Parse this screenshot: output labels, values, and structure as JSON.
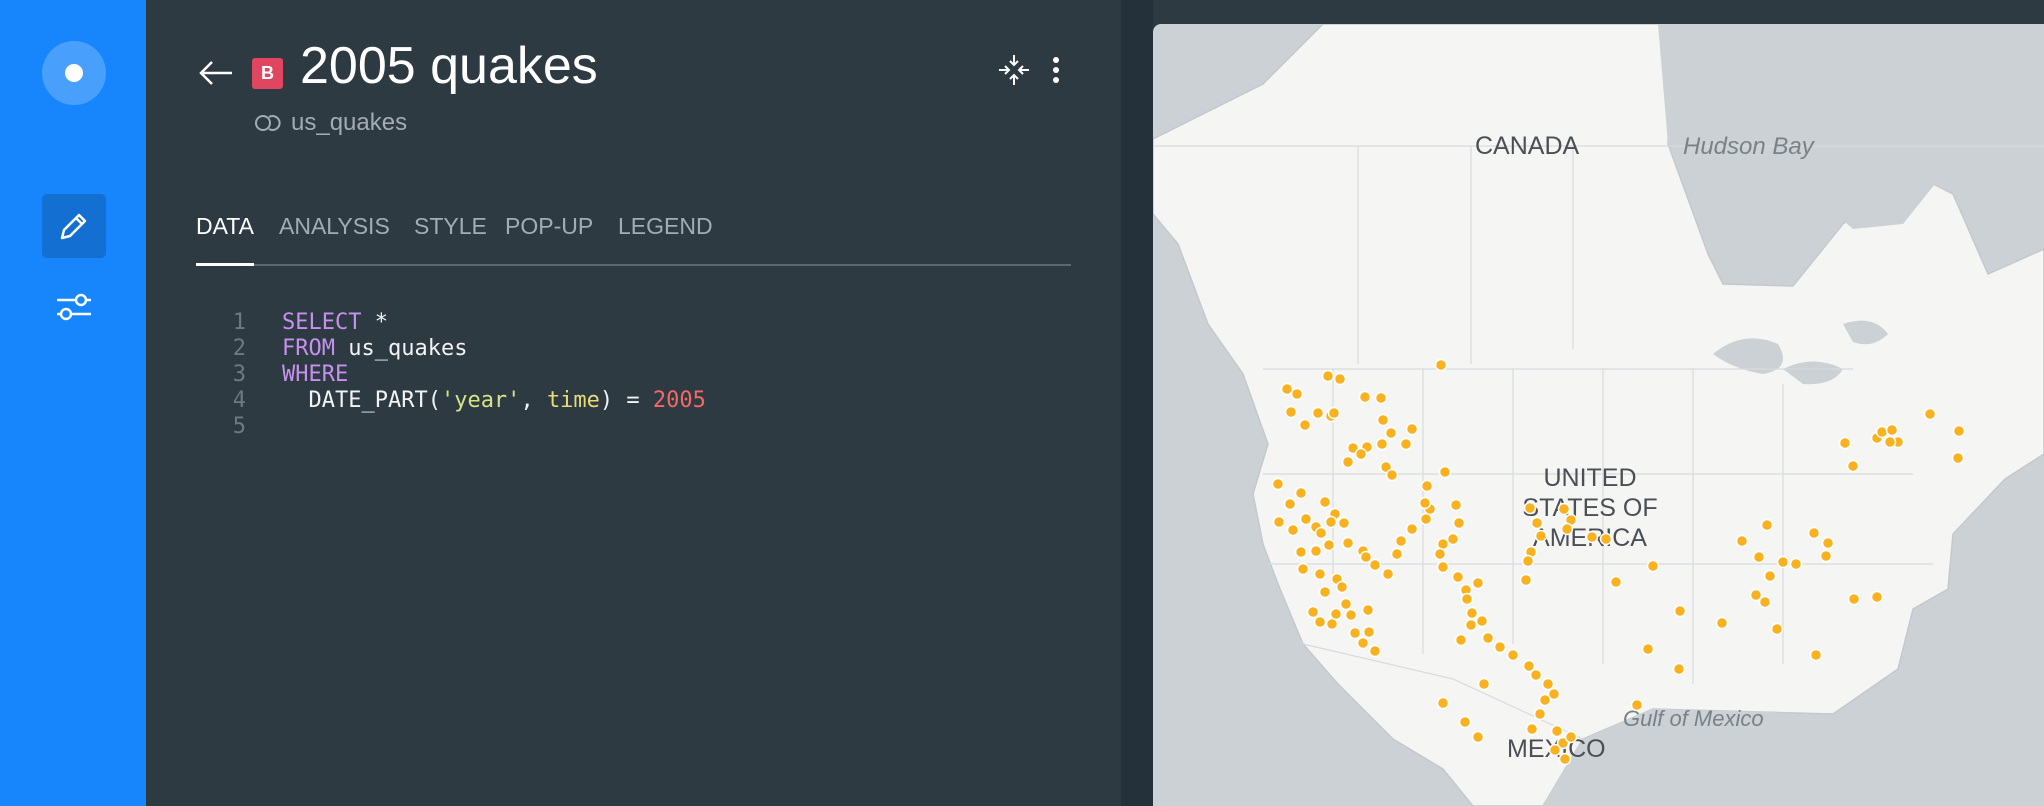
{
  "sidebar": {
    "logo_icon": "carto-logo-icon",
    "items": [
      {
        "name": "edit",
        "icon": "pencil-icon",
        "active": true
      },
      {
        "name": "settings",
        "icon": "sliders-icon",
        "active": false
      }
    ]
  },
  "layer": {
    "badge": "B",
    "title": "2005 quakes",
    "source": "us_quakes"
  },
  "tabs": [
    {
      "label": "DATA",
      "active": true
    },
    {
      "label": "ANALYSIS",
      "active": false
    },
    {
      "label": "STYLE",
      "active": false
    },
    {
      "label": "POP-UP",
      "active": false
    },
    {
      "label": "LEGEND",
      "active": false
    }
  ],
  "sql": {
    "line_numbers": [
      "1",
      "2",
      "3",
      "4",
      "5"
    ],
    "lines": [
      [
        {
          "t": "SELECT",
          "c": "kw"
        },
        {
          "t": " *",
          "c": "plain"
        }
      ],
      [
        {
          "t": "FROM",
          "c": "kw"
        },
        {
          "t": " us_quakes",
          "c": "plain"
        }
      ],
      [
        {
          "t": "WHERE",
          "c": "kw"
        }
      ],
      [
        {
          "t": "  DATE_PART(",
          "c": "plain"
        },
        {
          "t": "'year'",
          "c": "str"
        },
        {
          "t": ", ",
          "c": "plain"
        },
        {
          "t": "time",
          "c": "fn"
        },
        {
          "t": ") = ",
          "c": "plain"
        },
        {
          "t": "2005",
          "c": "num"
        }
      ],
      []
    ]
  },
  "map": {
    "labels": {
      "canada": "CANADA",
      "hudson_bay": "Hudson Bay",
      "usa_1": "UNITED",
      "usa_2": "STATES OF",
      "usa_3": "AMERICA",
      "mexico": "MEXICO",
      "gulf": "Gulf of Mexico"
    },
    "colors": {
      "land": "#f5f5f3",
      "water": "#cbd1d5",
      "border": "#c4c9cc",
      "point": "#f9b21f",
      "point_stroke": "#ffffff"
    },
    "point_style": "orange-dot"
  },
  "colors": {
    "sidebar": "#1785fb",
    "panel": "#2e3a42",
    "badge": "#e0465f"
  }
}
